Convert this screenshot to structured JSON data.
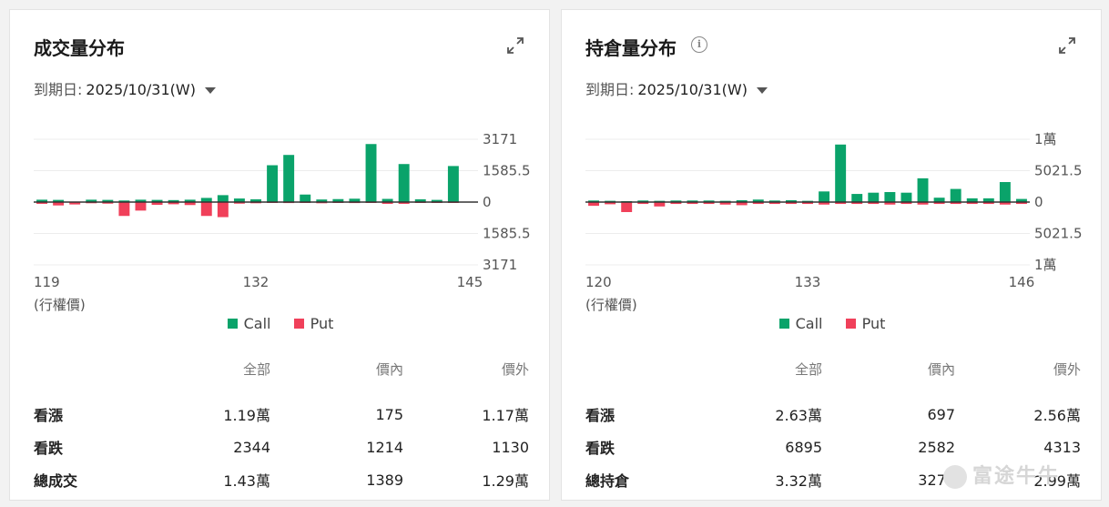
{
  "cards": [
    {
      "title": "成交量分布",
      "expiry_label": "到期日:",
      "expiry_value": "2025/10/31(W)",
      "chart_data": {
        "type": "bar",
        "x": [
          119,
          120,
          121,
          122,
          123,
          124,
          125,
          126,
          127,
          128,
          129,
          130,
          131,
          132,
          133,
          134,
          135,
          136,
          137,
          138,
          139,
          140,
          141,
          142,
          143,
          144,
          145
        ],
        "x_ticks": [
          "119",
          "132",
          "145"
        ],
        "xlabel": "(行權價)",
        "y_ticks": [
          "3171",
          "1585.5",
          "0",
          "1585.5",
          "3171"
        ],
        "ylim": [
          -3171,
          3171
        ],
        "series": [
          {
            "name": "Call",
            "color": "#0aa36a",
            "values": [
              120,
              110,
              20,
              120,
              110,
              80,
              120,
              110,
              100,
              120,
              210,
              350,
              180,
              140,
              1860,
              2380,
              380,
              130,
              150,
              170,
              2930,
              160,
              1920,
              140,
              110,
              1820,
              0
            ]
          },
          {
            "name": "Put",
            "color": "#f0405a",
            "values": [
              -90,
              -170,
              -120,
              -60,
              -80,
              -700,
              -430,
              -140,
              -110,
              -150,
              -700,
              -760,
              -80,
              -60,
              -40,
              -50,
              -30,
              -60,
              -40,
              -50,
              -30,
              -90,
              -90,
              -40,
              -30,
              -40,
              0
            ]
          }
        ],
        "legend": [
          "Call",
          "Put"
        ],
        "legend_position": "bottom"
      },
      "table": {
        "headers": [
          "全部",
          "價內",
          "價外"
        ],
        "rows": [
          {
            "label": "看漲",
            "values": [
              "1.19萬",
              "175",
              "1.17萬"
            ]
          },
          {
            "label": "看跌",
            "values": [
              "2344",
              "1214",
              "1130"
            ]
          },
          {
            "label": "總成交",
            "values": [
              "1.43萬",
              "1389",
              "1.29萬"
            ]
          }
        ]
      }
    },
    {
      "title": "持倉量分布",
      "expiry_label": "到期日:",
      "expiry_value": "2025/10/31(W)",
      "chart_data": {
        "type": "bar",
        "x": [
          120,
          121,
          122,
          123,
          124,
          125,
          126,
          127,
          128,
          129,
          130,
          131,
          132,
          133,
          134,
          135,
          136,
          137,
          138,
          139,
          140,
          141,
          142,
          143,
          144,
          145,
          146
        ],
        "x_ticks": [
          "120",
          "133",
          "146"
        ],
        "xlabel": "(行權價)",
        "y_ticks": [
          "1萬",
          "5021.5",
          "0",
          "5021.5",
          "1萬"
        ],
        "ylim": [
          -10043,
          10043
        ],
        "series": [
          {
            "name": "Call",
            "color": "#0aa36a",
            "values": [
              250,
              200,
              150,
              250,
              200,
              250,
              250,
              250,
              200,
              300,
              400,
              250,
              300,
              200,
              1700,
              9200,
              1300,
              1500,
              1600,
              1500,
              3800,
              700,
              2100,
              600,
              600,
              3200,
              500
            ]
          },
          {
            "name": "Put",
            "color": "#f0405a",
            "values": [
              -600,
              -350,
              -1600,
              -300,
              -700,
              -300,
              -300,
              -300,
              -400,
              -500,
              -300,
              -300,
              -300,
              -300,
              -400,
              -300,
              -300,
              -300,
              -400,
              -300,
              -400,
              -300,
              -300,
              -300,
              -300,
              -400,
              -300
            ]
          }
        ],
        "legend": [
          "Call",
          "Put"
        ],
        "legend_position": "bottom"
      },
      "table": {
        "headers": [
          "全部",
          "價內",
          "價外"
        ],
        "rows": [
          {
            "label": "看漲",
            "values": [
              "2.63萬",
              "697",
              "2.56萬"
            ]
          },
          {
            "label": "看跌",
            "values": [
              "6895",
              "2582",
              "4313"
            ]
          },
          {
            "label": "總持倉",
            "values": [
              "3.32萬",
              "3279",
              "2.99萬"
            ]
          }
        ]
      }
    }
  ],
  "icons": {
    "expand": "expand-icon",
    "info": "info-icon"
  },
  "watermark": "富途牛牛"
}
